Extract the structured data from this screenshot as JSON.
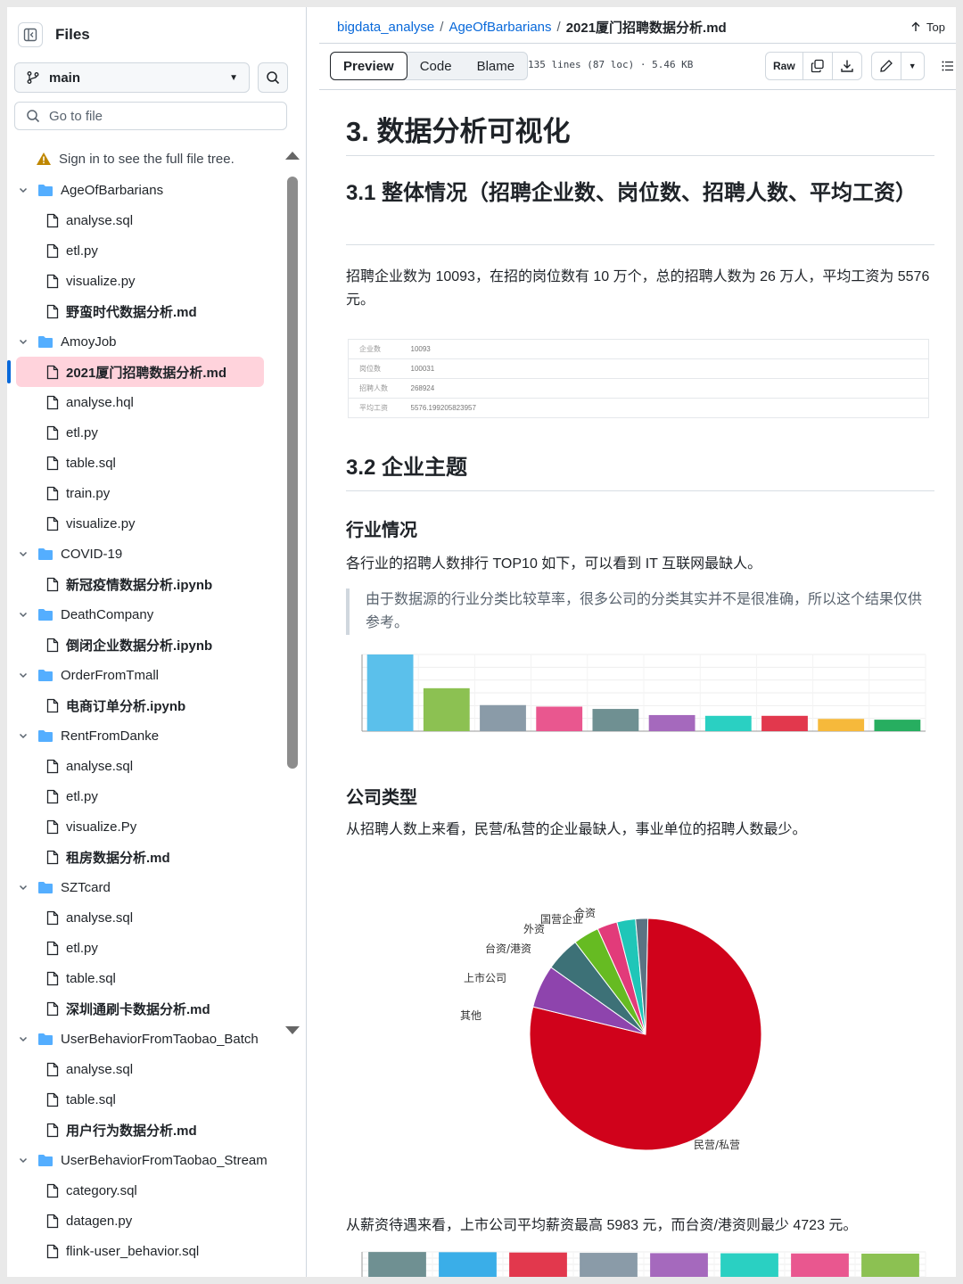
{
  "sidebar": {
    "title": "Files",
    "branch": "main",
    "goto_placeholder": "Go to file",
    "warning": "Sign in to see the full file tree.",
    "tree": [
      {
        "type": "folder",
        "label": "AgeOfBarbarians"
      },
      {
        "type": "file",
        "label": "analyse.sql"
      },
      {
        "type": "file",
        "label": "etl.py"
      },
      {
        "type": "file",
        "label": "visualize.py"
      },
      {
        "type": "file",
        "label": "野蛮时代数据分析.md",
        "bold": true
      },
      {
        "type": "folder",
        "label": "AmoyJob"
      },
      {
        "type": "file",
        "label": "2021厦门招聘数据分析.md",
        "bold": true,
        "active": true
      },
      {
        "type": "file",
        "label": "analyse.hql"
      },
      {
        "type": "file",
        "label": "etl.py"
      },
      {
        "type": "file",
        "label": "table.sql"
      },
      {
        "type": "file",
        "label": "train.py"
      },
      {
        "type": "file",
        "label": "visualize.py"
      },
      {
        "type": "folder",
        "label": "COVID-19"
      },
      {
        "type": "file",
        "label": "新冠疫情数据分析.ipynb",
        "bold": true
      },
      {
        "type": "folder",
        "label": "DeathCompany"
      },
      {
        "type": "file",
        "label": "倒闭企业数据分析.ipynb",
        "bold": true
      },
      {
        "type": "folder",
        "label": "OrderFromTmall"
      },
      {
        "type": "file",
        "label": "电商订单分析.ipynb",
        "bold": true
      },
      {
        "type": "folder",
        "label": "RentFromDanke"
      },
      {
        "type": "file",
        "label": "analyse.sql"
      },
      {
        "type": "file",
        "label": "etl.py"
      },
      {
        "type": "file",
        "label": "visualize.Py"
      },
      {
        "type": "file",
        "label": "租房数据分析.md",
        "bold": true
      },
      {
        "type": "folder",
        "label": "SZTcard"
      },
      {
        "type": "file",
        "label": "analyse.sql"
      },
      {
        "type": "file",
        "label": "etl.py"
      },
      {
        "type": "file",
        "label": "table.sql"
      },
      {
        "type": "file",
        "label": "深圳通刷卡数据分析.md",
        "bold": true
      },
      {
        "type": "folder",
        "label": "UserBehaviorFromTaobao_Batch"
      },
      {
        "type": "file",
        "label": "analyse.sql"
      },
      {
        "type": "file",
        "label": "table.sql"
      },
      {
        "type": "file",
        "label": "用户行为数据分析.md",
        "bold": true
      },
      {
        "type": "folder",
        "label": "UserBehaviorFromTaobao_Stream"
      },
      {
        "type": "file",
        "label": "category.sql"
      },
      {
        "type": "file",
        "label": "datagen.py"
      },
      {
        "type": "file",
        "label": "flink-user_behavior.sql"
      }
    ]
  },
  "breadcrumb": {
    "repo": "bigdata_analyse",
    "folder": "AgeOfBarbarians",
    "file": "2021厦门招聘数据分析.md",
    "top": "Top"
  },
  "toolbar": {
    "tabs": [
      "Preview",
      "Code",
      "Blame"
    ],
    "meta": "135 lines (87 loc) · 5.46 KB",
    "raw": "Raw"
  },
  "doc": {
    "h1": "3. 数据分析可视化",
    "h2_overall": "3.1 整体情况（招聘企业数、岗位数、招聘人数、平均工资）",
    "p_overall": "招聘企业数为 10093，在招的岗位数有 10 万个，总的招聘人数为 26 万人，平均工资为 5576 元。",
    "stats": [
      {
        "k": "企业数",
        "v": "10093"
      },
      {
        "k": "岗位数",
        "v": "100031"
      },
      {
        "k": "招聘人数",
        "v": "268924"
      },
      {
        "k": "平均工资",
        "v": "5576.199205823957"
      }
    ],
    "h2_company": "3.2 企业主题",
    "h3_industry": "行业情况",
    "p_industry": "各行业的招聘人数排行 TOP10 如下，可以看到 IT 互联网最缺人。",
    "quote": "由于数据源的行业分类比较草率，很多公司的分类其实并不是很准确，所以这个结果仅供参考。",
    "h3_type": "公司类型",
    "p_type": "从招聘人数上来看，民营/私营的企业最缺人，事业单位的招聘人数最少。",
    "p_salary": "从薪资待遇来看，上市公司平均薪资最高 5983 元，而台资/港资则最少 4723 元。"
  },
  "colors": {
    "link": "#0969da",
    "active_bg": "#ffd3dc",
    "folder": "#54aeff"
  },
  "chart_data": [
    {
      "type": "bar",
      "title": "",
      "categories": [
        "",
        "",
        "",
        "",
        "",
        "",
        "",
        "",
        "",
        ""
      ],
      "values": [
        100,
        56,
        34,
        32,
        29,
        21,
        20,
        20,
        16,
        15
      ],
      "colors": [
        "#5bc0eb",
        "#8cc152",
        "#8a9ba8",
        "#e9578f",
        "#6f9092",
        "#a569bd",
        "#2ad0c2",
        "#e2384d",
        "#f6b93b",
        "#27ae60"
      ],
      "ylim": [
        0,
        100
      ],
      "grid": true
    },
    {
      "type": "pie",
      "title": "",
      "labels": [
        "民营/私营",
        "其他",
        "上市公司",
        "台资/港资",
        "外资",
        "国营企业",
        "合资"
      ],
      "values": [
        78.5,
        6.0,
        4.8,
        3.6,
        2.8,
        2.6,
        1.7
      ],
      "colors": [
        "#d0021b",
        "#8e44ad",
        "#3d7177",
        "#66bb22",
        "#e23b7a",
        "#1fc6b8",
        "#5b7383"
      ]
    },
    {
      "type": "bar",
      "title": "",
      "categories": [
        "",
        "",
        "",
        "",
        "",
        "",
        "",
        ""
      ],
      "values": [
        5983,
        5950,
        5900,
        5850,
        5800,
        5780,
        5750,
        5720
      ],
      "colors": [
        "#6f9092",
        "#3aaee8",
        "#e2384d",
        "#8a9ba8",
        "#a569bd",
        "#2ad0c2",
        "#e9578f",
        "#8cc152"
      ],
      "ylim": [
        0,
        6000
      ],
      "grid": true
    }
  ]
}
